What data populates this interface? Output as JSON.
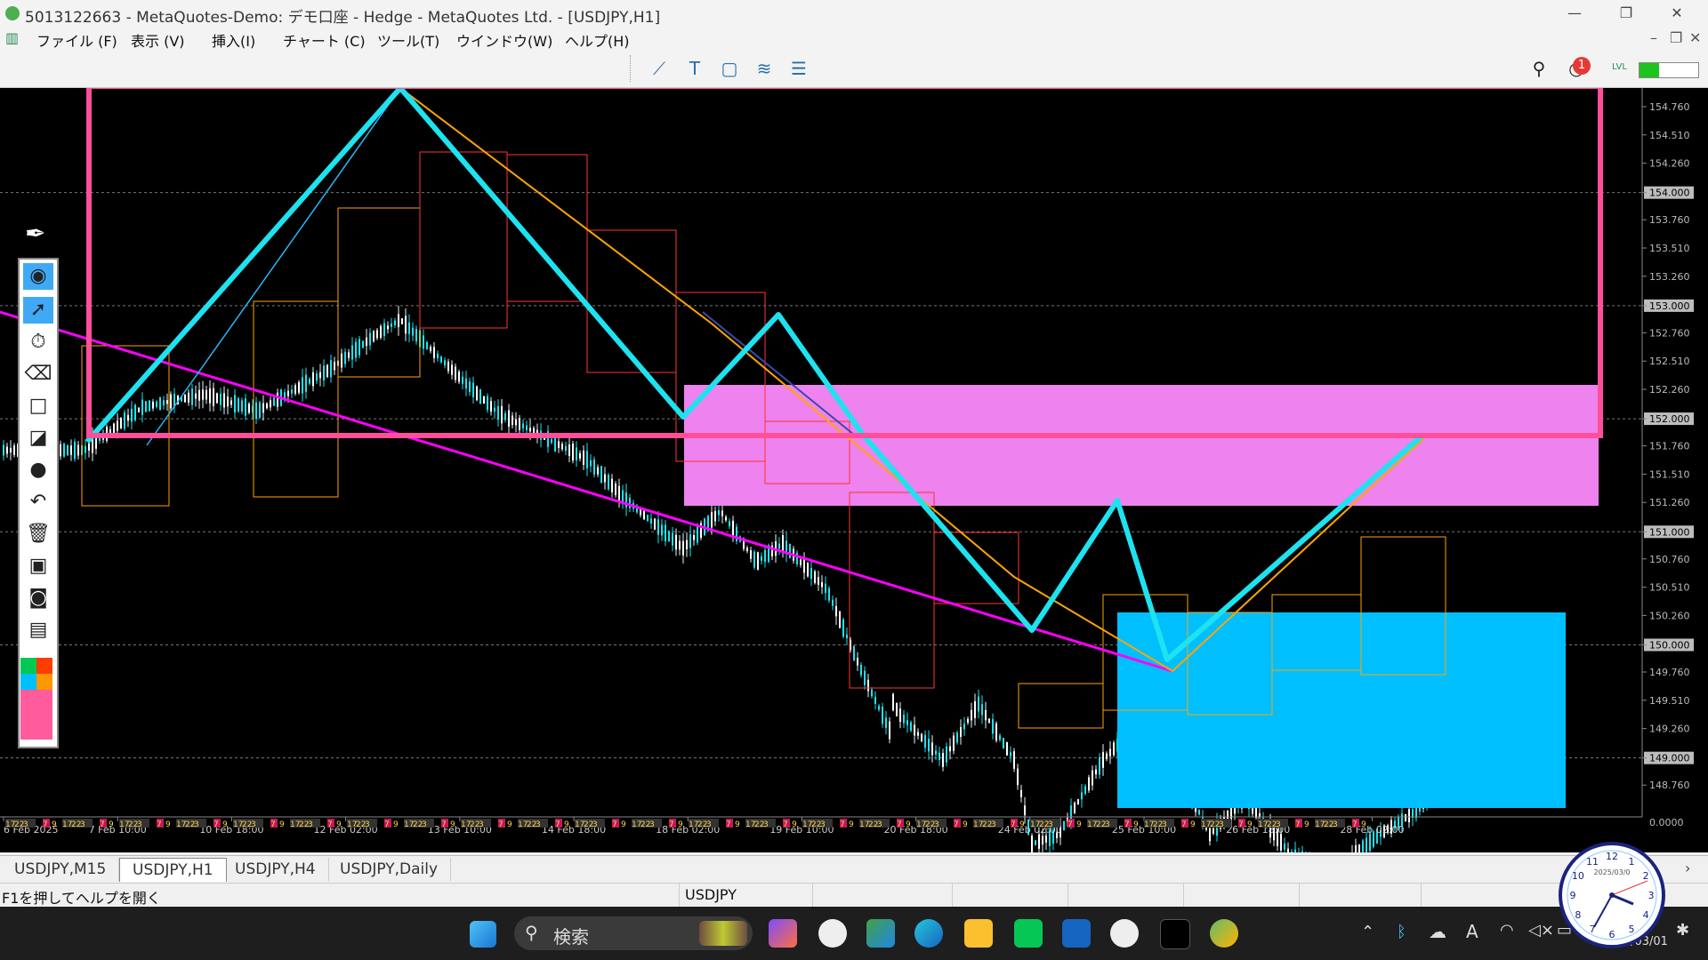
{
  "window": {
    "title": "5013122663 - MetaQuotes-Demo: デモ口座 - Hedge - MetaQuotes Ltd. - [USDJPY,H1]",
    "minimize": "—",
    "maximize": "❐",
    "close": "✕"
  },
  "menu": {
    "items": [
      "ファイル (F)",
      "表示 (V)",
      "挿入(I)",
      "チャート (C)",
      "ツール(T)",
      "ウインドウ(W)",
      "ヘルプ(H)"
    ]
  },
  "toolbar": {
    "notifications": "1",
    "lvl": "LVL"
  },
  "chart": {
    "symbol_timeframe": "USDJPY,H1",
    "price_labels": [
      "154.760",
      "154.510",
      "154.260",
      "154.000",
      "153.760",
      "153.510",
      "153.260",
      "153.000",
      "152.760",
      "152.510",
      "152.260",
      "152.000",
      "151.760",
      "151.510",
      "151.260",
      "151.000",
      "150.760",
      "150.510",
      "150.260",
      "150.000",
      "149.760",
      "149.510",
      "149.260",
      "149.000",
      "148.760"
    ],
    "highlighted_prices": [
      "154.000",
      "153.000",
      "152.000",
      "151.000",
      "150.000",
      "149.000"
    ],
    "zero_label": "0.0000",
    "time_labels": [
      "6 Feb 2025",
      "7 Feb 10:00",
      "10 Feb 18:00",
      "12 Feb 02:00",
      "13 Feb 10:00",
      "14 Feb 18:00",
      "18 Feb 02:00",
      "19 Feb 10:00",
      "20 Feb 18:00",
      "24 Feb 02:00",
      "25 Feb 10:00",
      "26 Feb 18:00",
      "28 Feb 02:00"
    ],
    "session_strip_labels": [
      "17",
      "22",
      "3",
      "7",
      "9"
    ],
    "colors": {
      "zone_border": "#ff4f9a",
      "supply_zone": "#ee82ee",
      "demand_zone": "#00bfff",
      "zigzag": "#1de3f0",
      "trend_orange": "#ffa500",
      "trend_magenta": "#ff00ff"
    }
  },
  "tabs": {
    "items": [
      "USDJPY,M15",
      "USDJPY,H1",
      "USDJPY,H4",
      "USDJPY,Daily"
    ],
    "active": "USDJPY,H1"
  },
  "status": {
    "help": "F1を押してヘルプを開く",
    "symbol": "USDJPY"
  },
  "taskbar": {
    "search_placeholder": "検索",
    "date": "2025/03/01",
    "clock_date": "2025/03/0"
  }
}
